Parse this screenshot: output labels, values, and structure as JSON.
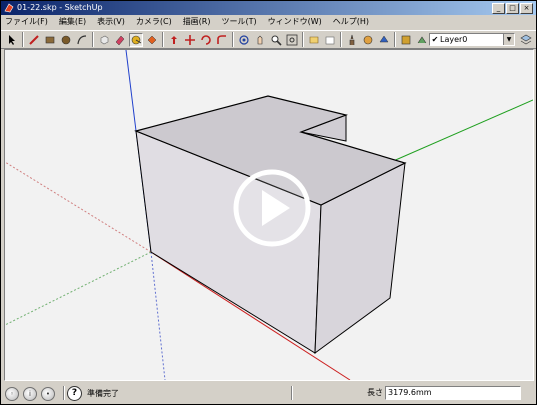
{
  "window": {
    "title": "01-22.skp - SketchUp",
    "buttons": {
      "minimize": "_",
      "maximize": "□",
      "close": "×"
    }
  },
  "menu": {
    "items": [
      "ファイル(F)",
      "編集(E)",
      "表示(V)",
      "カメラ(C)",
      "描画(R)",
      "ツール(T)",
      "ウィンドウ(W)",
      "ヘルプ(H)"
    ]
  },
  "toolbar": {
    "tools": [
      "select-icon",
      "line-icon",
      "rectangle-icon",
      "circle-icon",
      "arc-icon",
      "make-component-icon",
      "eraser-icon",
      "tape-measure-icon",
      "paint-bucket-icon",
      "push-pull-icon",
      "move-icon",
      "rotate-icon",
      "follow-me-icon",
      "orbit-icon",
      "pan-icon",
      "zoom-icon",
      "zoom-extents-icon",
      "section-icon",
      "warehouse-icon",
      "walk-icon",
      "look-around-icon",
      "position-camera-icon",
      "get-models-icon",
      "share-icon"
    ],
    "layer": {
      "checked": "✔",
      "value": "Layer0",
      "arrow": "▼"
    }
  },
  "status": {
    "text": "準備完了",
    "help": "?",
    "length_label": "長さ",
    "length_value": "3179.6mm"
  },
  "colors": {
    "titlebar_start": "#0a246a",
    "titlebar_end": "#a6caf0",
    "axis_red": "#cc2020",
    "axis_green": "#20a020",
    "axis_blue": "#2040cc",
    "model_face": "#e0dde3",
    "model_top": "#ccc9cf"
  }
}
